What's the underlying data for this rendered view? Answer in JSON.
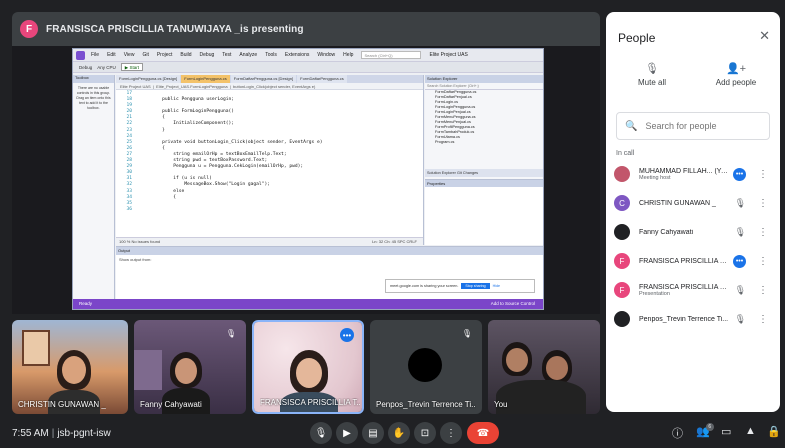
{
  "presenting": {
    "avatar_letter": "F",
    "label": "FRANSISCA PRISCILLIA TANUWIJAYA _is presenting"
  },
  "vs": {
    "menu": [
      "File",
      "Edit",
      "View",
      "Git",
      "Project",
      "Build",
      "Debug",
      "Test",
      "Analyze",
      "Tools",
      "Extensions",
      "Window",
      "Help"
    ],
    "search_placeholder": "Search (Ctrl+Q)",
    "project": "Elite Project UAS",
    "toolbar_config": "Debug",
    "toolbar_platform": "Any CPU",
    "toolbar_start": "▶ Start",
    "toolbox_title": "Toolbox",
    "toolbox_placeholder": "There are no usable controls in this group. Drag an item onto this text to add it to the toolbox.",
    "tabs": [
      "FormLoginPengguna.cs [Design]",
      "FormLoginPengguna.cs",
      "FormDaftarPengguna.cs [Design]",
      "FormDaftarPengguna.cs"
    ],
    "nav_left": "Elite Project UAS",
    "nav_mid": "Elite_Project_UAS.FormLoginPengguna",
    "nav_right": "buttonLogin_Click(object sender, EventArgs e)",
    "code": [
      {
        "n": "17",
        "code": ""
      },
      {
        "n": "18",
        "code": "        public Pengguna userLogin;"
      },
      {
        "n": "19",
        "code": ""
      },
      {
        "n": "20",
        "code": "        public FormLoginPengguna()"
      },
      {
        "n": "21",
        "code": "        {"
      },
      {
        "n": "22",
        "code": "            InitializeComponent();"
      },
      {
        "n": "23",
        "code": "        }"
      },
      {
        "n": "24",
        "code": ""
      },
      {
        "n": "25",
        "code": "        private void buttonLogin_Click(object sender, EventArgs e)"
      },
      {
        "n": "26",
        "code": "        {"
      },
      {
        "n": "27",
        "code": "            string emailOrHp = textBoxEmailTelp.Text;"
      },
      {
        "n": "28",
        "code": "            string pwd = textBoxPassword.Text;"
      },
      {
        "n": "29",
        "code": "            Pengguna u = Pengguna.CekLogin(emailOrHp, pwd);"
      },
      {
        "n": "30",
        "code": ""
      },
      {
        "n": "31",
        "code": "            if (u is null)"
      },
      {
        "n": "32",
        "code": "                MessageBox.Show(\"Login gagal\");"
      },
      {
        "n": "33",
        "code": "            else"
      },
      {
        "n": "34",
        "code": "            {"
      },
      {
        "n": "35",
        "code": ""
      },
      {
        "n": "36",
        "code": ""
      }
    ],
    "editor_status": "100 %    No issues found",
    "editor_pos": "Ln: 32   Ch: 45   SPC   CRLF",
    "solution_title": "Solution Explorer",
    "solution_search": "Search Solution Explorer (Ctrl+;)",
    "solution_items": [
      "FormDaftarPengguna.cs",
      "FormDaftarPenjual.cs",
      "FormLogin.cs",
      "FormLoginPengguna.cs",
      "FormLoginPenjual.cs",
      "FormMenuPengguna.cs",
      "FormMenuPenjual.cs",
      "FormProfilPengguna.cs",
      "FormTambahProduk.cs",
      "FormUtama.cs",
      "Program.cs"
    ],
    "se_tabs": "Solution Explorer   Git Changes",
    "props_title": "Properties",
    "output_title": "Output",
    "output_show": "Show output from:",
    "notif_text": "meet.google.com is sharing your screen.",
    "notif_stop": "Stop sharing",
    "notif_hide": "Hide",
    "status_left": "Ready",
    "status_right": "Add to Source Control"
  },
  "tiles": [
    {
      "name": "CHRISTIN GUNAWAN _",
      "bg": "#c77b52"
    },
    {
      "name": "Fanny Cahyawati",
      "bg": "#4a3a5c"
    },
    {
      "name": "FRANSISCA PRISCILLIA T...",
      "bg": "#e9d3da",
      "speaking": true
    },
    {
      "name": "Penpos_Trevin Terrence Ti...",
      "bg": "#3c4043"
    },
    {
      "name": "You",
      "bg": "#4a4350"
    }
  ],
  "bottom": {
    "time": "7:55 AM",
    "code": "jsb-pgnt-isw",
    "participant_count": "6"
  },
  "people": {
    "title": "People",
    "mute_all": "Mute all",
    "add_people": "Add people",
    "search_placeholder": "Search for people",
    "section": "In call",
    "rows": [
      {
        "name": "MUHAMMAD FILLAH... (You)",
        "sub": "Meeting host",
        "av": "#c2566b",
        "letter": "",
        "status": "speaking"
      },
      {
        "name": "CHRISTIN GUNAWAN _",
        "sub": "",
        "av": "#7e57c2",
        "letter": "C",
        "status": "muted"
      },
      {
        "name": "Fanny Cahyawati",
        "sub": "",
        "av": "#202124",
        "letter": "",
        "status": "muted"
      },
      {
        "name": "FRANSISCA PRISCILLIA TA...",
        "sub": "",
        "av": "#e8467c",
        "letter": "F",
        "status": "speaking"
      },
      {
        "name": "FRANSISCA PRISCILLIA TA...",
        "sub": "Presentation",
        "av": "#e8467c",
        "letter": "F",
        "status": "muted"
      },
      {
        "name": "Penpos_Trevin Terrence Ti...",
        "sub": "",
        "av": "#202124",
        "letter": "",
        "status": "muted"
      }
    ]
  }
}
